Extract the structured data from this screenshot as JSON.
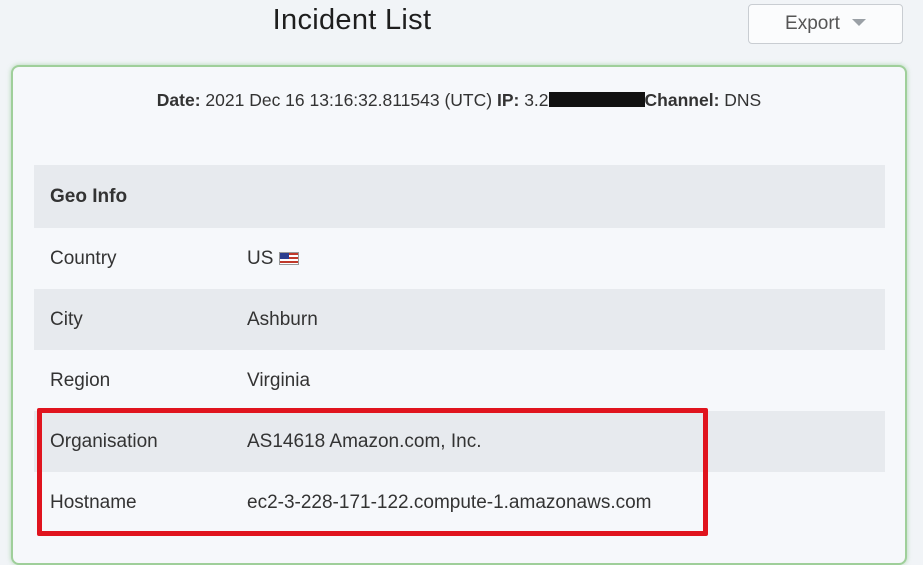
{
  "header": {
    "title": "Incident List",
    "export_label": "Export"
  },
  "meta": {
    "date_label": "Date:",
    "date_value": "2021 Dec 16 13:16:32.811543 (UTC)",
    "ip_label": "IP:",
    "ip_value_visible": "3.2",
    "channel_label": "Channel:",
    "channel_value": "DNS"
  },
  "geo": {
    "section_title": "Geo Info",
    "rows": [
      {
        "label": "Country",
        "value": "US",
        "icon": "us-flag-icon"
      },
      {
        "label": "City",
        "value": "Ashburn"
      },
      {
        "label": "Region",
        "value": "Virginia"
      },
      {
        "label": "Organisation",
        "value": "AS14618 Amazon.com, Inc."
      },
      {
        "label": "Hostname",
        "value": "ec2-3-228-171-122.compute-1.amazonaws.com"
      }
    ]
  },
  "highlight_color": "#e0141e",
  "accent_border_color": "#9fcf9a"
}
